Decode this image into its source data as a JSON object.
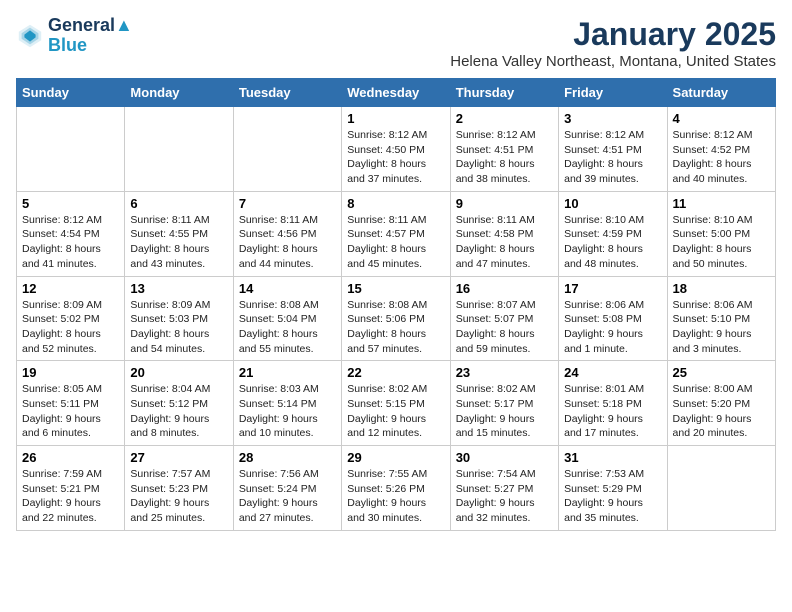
{
  "logo": {
    "line1": "General",
    "line2": "Blue"
  },
  "title": "January 2025",
  "location": "Helena Valley Northeast, Montana, United States",
  "weekdays": [
    "Sunday",
    "Monday",
    "Tuesday",
    "Wednesday",
    "Thursday",
    "Friday",
    "Saturday"
  ],
  "weeks": [
    [
      {
        "day": "",
        "info": ""
      },
      {
        "day": "",
        "info": ""
      },
      {
        "day": "",
        "info": ""
      },
      {
        "day": "1",
        "info": "Sunrise: 8:12 AM\nSunset: 4:50 PM\nDaylight: 8 hours and 37 minutes."
      },
      {
        "day": "2",
        "info": "Sunrise: 8:12 AM\nSunset: 4:51 PM\nDaylight: 8 hours and 38 minutes."
      },
      {
        "day": "3",
        "info": "Sunrise: 8:12 AM\nSunset: 4:51 PM\nDaylight: 8 hours and 39 minutes."
      },
      {
        "day": "4",
        "info": "Sunrise: 8:12 AM\nSunset: 4:52 PM\nDaylight: 8 hours and 40 minutes."
      }
    ],
    [
      {
        "day": "5",
        "info": "Sunrise: 8:12 AM\nSunset: 4:54 PM\nDaylight: 8 hours and 41 minutes."
      },
      {
        "day": "6",
        "info": "Sunrise: 8:11 AM\nSunset: 4:55 PM\nDaylight: 8 hours and 43 minutes."
      },
      {
        "day": "7",
        "info": "Sunrise: 8:11 AM\nSunset: 4:56 PM\nDaylight: 8 hours and 44 minutes."
      },
      {
        "day": "8",
        "info": "Sunrise: 8:11 AM\nSunset: 4:57 PM\nDaylight: 8 hours and 45 minutes."
      },
      {
        "day": "9",
        "info": "Sunrise: 8:11 AM\nSunset: 4:58 PM\nDaylight: 8 hours and 47 minutes."
      },
      {
        "day": "10",
        "info": "Sunrise: 8:10 AM\nSunset: 4:59 PM\nDaylight: 8 hours and 48 minutes."
      },
      {
        "day": "11",
        "info": "Sunrise: 8:10 AM\nSunset: 5:00 PM\nDaylight: 8 hours and 50 minutes."
      }
    ],
    [
      {
        "day": "12",
        "info": "Sunrise: 8:09 AM\nSunset: 5:02 PM\nDaylight: 8 hours and 52 minutes."
      },
      {
        "day": "13",
        "info": "Sunrise: 8:09 AM\nSunset: 5:03 PM\nDaylight: 8 hours and 54 minutes."
      },
      {
        "day": "14",
        "info": "Sunrise: 8:08 AM\nSunset: 5:04 PM\nDaylight: 8 hours and 55 minutes."
      },
      {
        "day": "15",
        "info": "Sunrise: 8:08 AM\nSunset: 5:06 PM\nDaylight: 8 hours and 57 minutes."
      },
      {
        "day": "16",
        "info": "Sunrise: 8:07 AM\nSunset: 5:07 PM\nDaylight: 8 hours and 59 minutes."
      },
      {
        "day": "17",
        "info": "Sunrise: 8:06 AM\nSunset: 5:08 PM\nDaylight: 9 hours and 1 minute."
      },
      {
        "day": "18",
        "info": "Sunrise: 8:06 AM\nSunset: 5:10 PM\nDaylight: 9 hours and 3 minutes."
      }
    ],
    [
      {
        "day": "19",
        "info": "Sunrise: 8:05 AM\nSunset: 5:11 PM\nDaylight: 9 hours and 6 minutes."
      },
      {
        "day": "20",
        "info": "Sunrise: 8:04 AM\nSunset: 5:12 PM\nDaylight: 9 hours and 8 minutes."
      },
      {
        "day": "21",
        "info": "Sunrise: 8:03 AM\nSunset: 5:14 PM\nDaylight: 9 hours and 10 minutes."
      },
      {
        "day": "22",
        "info": "Sunrise: 8:02 AM\nSunset: 5:15 PM\nDaylight: 9 hours and 12 minutes."
      },
      {
        "day": "23",
        "info": "Sunrise: 8:02 AM\nSunset: 5:17 PM\nDaylight: 9 hours and 15 minutes."
      },
      {
        "day": "24",
        "info": "Sunrise: 8:01 AM\nSunset: 5:18 PM\nDaylight: 9 hours and 17 minutes."
      },
      {
        "day": "25",
        "info": "Sunrise: 8:00 AM\nSunset: 5:20 PM\nDaylight: 9 hours and 20 minutes."
      }
    ],
    [
      {
        "day": "26",
        "info": "Sunrise: 7:59 AM\nSunset: 5:21 PM\nDaylight: 9 hours and 22 minutes."
      },
      {
        "day": "27",
        "info": "Sunrise: 7:57 AM\nSunset: 5:23 PM\nDaylight: 9 hours and 25 minutes."
      },
      {
        "day": "28",
        "info": "Sunrise: 7:56 AM\nSunset: 5:24 PM\nDaylight: 9 hours and 27 minutes."
      },
      {
        "day": "29",
        "info": "Sunrise: 7:55 AM\nSunset: 5:26 PM\nDaylight: 9 hours and 30 minutes."
      },
      {
        "day": "30",
        "info": "Sunrise: 7:54 AM\nSunset: 5:27 PM\nDaylight: 9 hours and 32 minutes."
      },
      {
        "day": "31",
        "info": "Sunrise: 7:53 AM\nSunset: 5:29 PM\nDaylight: 9 hours and 35 minutes."
      },
      {
        "day": "",
        "info": ""
      }
    ]
  ]
}
